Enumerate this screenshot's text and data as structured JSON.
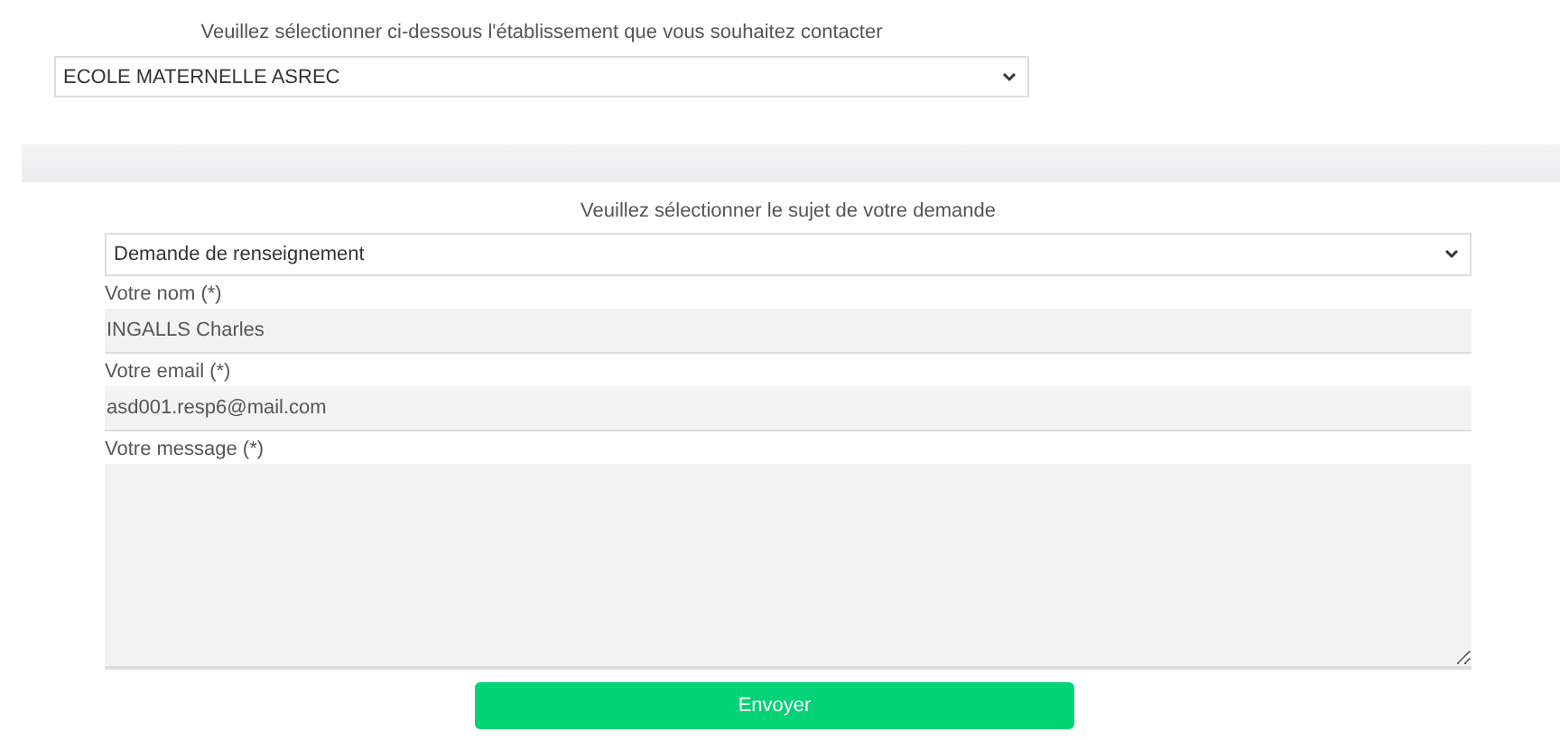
{
  "establishment": {
    "prompt": "Veuillez sélectionner ci-dessous l'établissement que vous souhaitez contacter",
    "value": "ECOLE MATERNELLE ASREC"
  },
  "form": {
    "prompt": "Veuillez sélectionner le sujet de votre demande",
    "subject": "Demande de renseignement",
    "fields": [
      {
        "kind": "input",
        "label": "Votre nom (*)",
        "value": "INGALLS Charles"
      },
      {
        "kind": "input",
        "label": "Votre email (*)",
        "value": "asd001.resp6@mail.com"
      },
      {
        "kind": "textarea",
        "label": "Votre message (*)"
      }
    ],
    "submit": "Envoyer"
  }
}
